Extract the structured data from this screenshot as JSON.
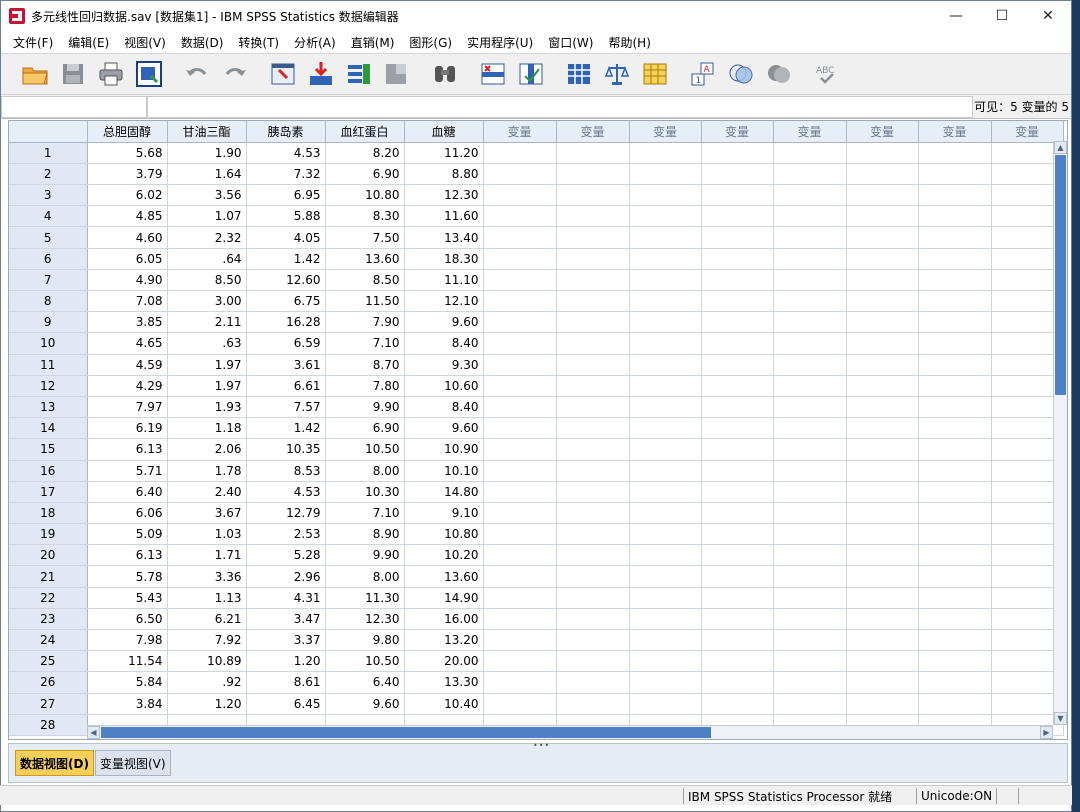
{
  "window": {
    "title": "多元线性回归数据.sav [数据集1] - IBM SPSS Statistics 数据编辑器",
    "minimize_glyph": "—",
    "maximize_glyph": "☐",
    "close_glyph": "✕"
  },
  "menu": {
    "items": [
      "文件(F)",
      "编辑(E)",
      "视图(V)",
      "数据(D)",
      "转换(T)",
      "分析(A)",
      "直销(M)",
      "图形(G)",
      "实用程序(U)",
      "窗口(W)",
      "帮助(H)"
    ]
  },
  "toolbar": {
    "icons": [
      "open-folder-icon",
      "save-icon",
      "print-icon",
      "dialog-recall-icon",
      "undo-icon",
      "redo-icon",
      "goto-case-icon",
      "goto-variable-icon",
      "variables-icon",
      "run-descriptives-icon",
      "find-icon",
      "insert-cases-icon",
      "insert-variable-icon",
      "split-file-icon",
      "weight-cases-icon",
      "select-cases-icon",
      "value-labels-icon",
      "use-sets-icon",
      "show-all-variables-icon",
      "spell-check-icon"
    ]
  },
  "editbar": {
    "visible_label": "可见：5 变量的 5"
  },
  "grid": {
    "columns": [
      "总胆固醇",
      "甘油三酯",
      "胰岛素",
      "血红蛋白",
      "血糖",
      "变量",
      "变量",
      "变量",
      "变量",
      "变量",
      "变量",
      "变量",
      "变量"
    ],
    "rows": [
      [
        "1",
        "5.68",
        "1.90",
        "4.53",
        "8.20",
        "11.20"
      ],
      [
        "2",
        "3.79",
        "1.64",
        "7.32",
        "6.90",
        "8.80"
      ],
      [
        "3",
        "6.02",
        "3.56",
        "6.95",
        "10.80",
        "12.30"
      ],
      [
        "4",
        "4.85",
        "1.07",
        "5.88",
        "8.30",
        "11.60"
      ],
      [
        "5",
        "4.60",
        "2.32",
        "4.05",
        "7.50",
        "13.40"
      ],
      [
        "6",
        "6.05",
        ".64",
        "1.42",
        "13.60",
        "18.30"
      ],
      [
        "7",
        "4.90",
        "8.50",
        "12.60",
        "8.50",
        "11.10"
      ],
      [
        "8",
        "7.08",
        "3.00",
        "6.75",
        "11.50",
        "12.10"
      ],
      [
        "9",
        "3.85",
        "2.11",
        "16.28",
        "7.90",
        "9.60"
      ],
      [
        "10",
        "4.65",
        ".63",
        "6.59",
        "7.10",
        "8.40"
      ],
      [
        "11",
        "4.59",
        "1.97",
        "3.61",
        "8.70",
        "9.30"
      ],
      [
        "12",
        "4.29",
        "1.97",
        "6.61",
        "7.80",
        "10.60"
      ],
      [
        "13",
        "7.97",
        "1.93",
        "7.57",
        "9.90",
        "8.40"
      ],
      [
        "14",
        "6.19",
        "1.18",
        "1.42",
        "6.90",
        "9.60"
      ],
      [
        "15",
        "6.13",
        "2.06",
        "10.35",
        "10.50",
        "10.90"
      ],
      [
        "16",
        "5.71",
        "1.78",
        "8.53",
        "8.00",
        "10.10"
      ],
      [
        "17",
        "6.40",
        "2.40",
        "4.53",
        "10.30",
        "14.80"
      ],
      [
        "18",
        "6.06",
        "3.67",
        "12.79",
        "7.10",
        "9.10"
      ],
      [
        "19",
        "5.09",
        "1.03",
        "2.53",
        "8.90",
        "10.80"
      ],
      [
        "20",
        "6.13",
        "1.71",
        "5.28",
        "9.90",
        "10.20"
      ],
      [
        "21",
        "5.78",
        "3.36",
        "2.96",
        "8.00",
        "13.60"
      ],
      [
        "22",
        "5.43",
        "1.13",
        "4.31",
        "11.30",
        "14.90"
      ],
      [
        "23",
        "6.50",
        "6.21",
        "3.47",
        "12.30",
        "16.00"
      ],
      [
        "24",
        "7.98",
        "7.92",
        "3.37",
        "9.80",
        "13.20"
      ],
      [
        "25",
        "11.54",
        "10.89",
        "1.20",
        "10.50",
        "20.00"
      ],
      [
        "26",
        "5.84",
        ".92",
        "8.61",
        "6.40",
        "13.30"
      ],
      [
        "27",
        "3.84",
        "1.20",
        "6.45",
        "9.60",
        "10.40"
      ],
      [
        "28",
        "",
        "",
        "",
        "",
        ""
      ]
    ]
  },
  "tabs": {
    "data_view": "数据视图(D)",
    "variable_view": "变量视图(V)"
  },
  "status": {
    "processor": "IBM SPSS Statistics Processor 就绪",
    "unicode": "Unicode:ON"
  },
  "colors": {
    "active_tab": "#f6cf5a",
    "scroll_thumb": "#4f7fc4",
    "header_bg": "#e6eef8"
  }
}
